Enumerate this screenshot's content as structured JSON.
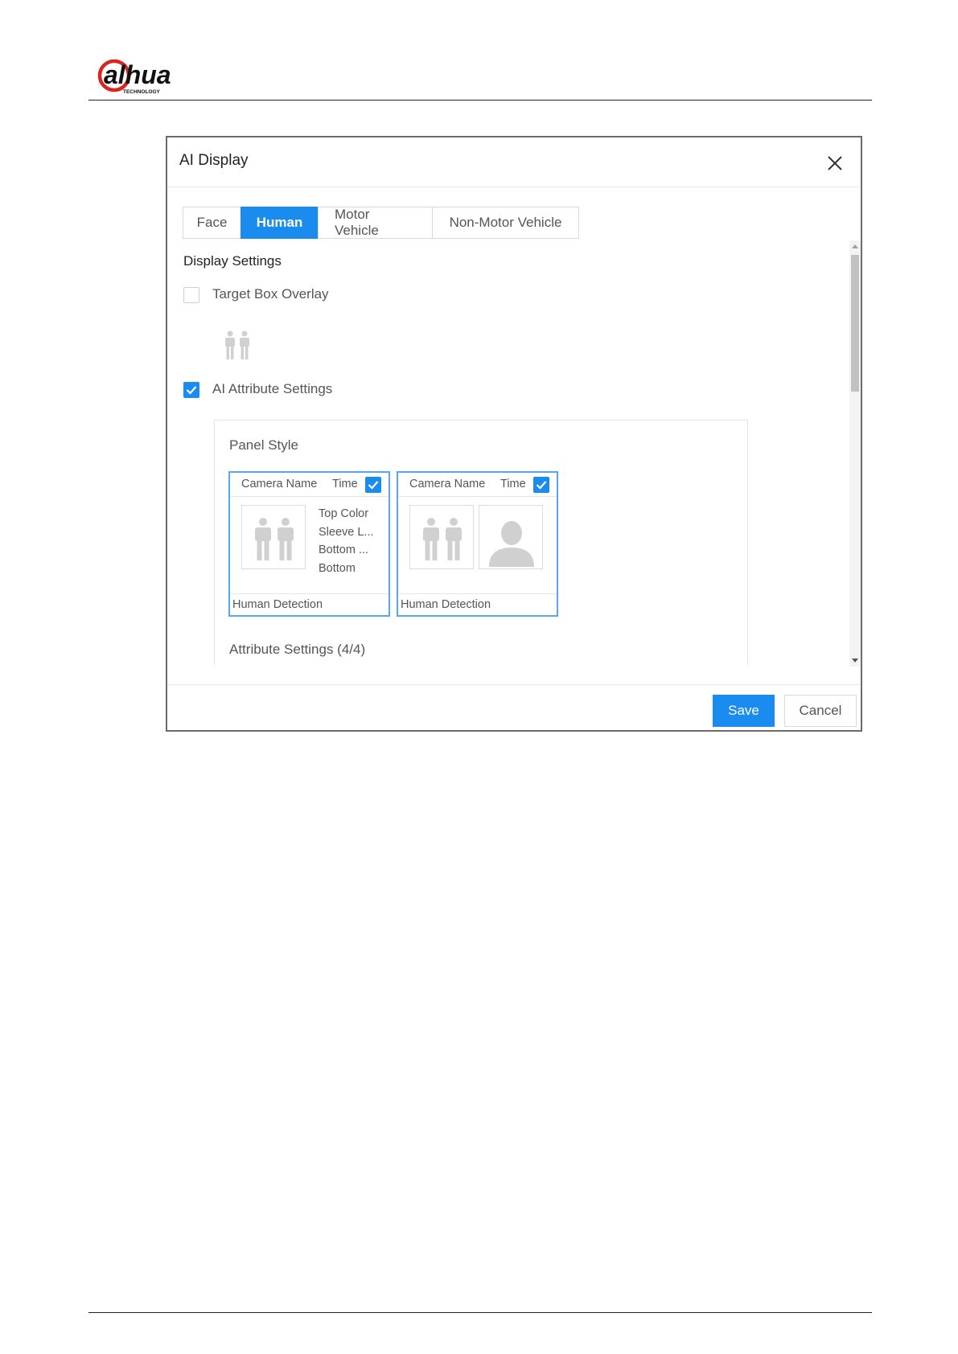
{
  "brand": {
    "logo_name": "alhua",
    "logo_sub": "TECHNOLOGY",
    "colors": {
      "brand_red": "#d9251d",
      "brand_dark": "#111111"
    }
  },
  "dialog": {
    "title": "AI Display",
    "close_icon": "close-icon",
    "tabs": [
      {
        "label": "Face",
        "active": false
      },
      {
        "label": "Human",
        "active": true
      },
      {
        "label": "Motor Vehicle",
        "active": false
      },
      {
        "label": "Non-Motor Vehicle",
        "active": false
      }
    ],
    "display_settings": {
      "title": "Display Settings",
      "target_box_overlay": {
        "label": "Target Box Overlay",
        "checked": false
      },
      "ai_attribute_settings": {
        "label": "AI Attribute Settings",
        "checked": true
      }
    },
    "panel": {
      "panel_style_label": "Panel Style",
      "cards": [
        {
          "camera_name": "Camera Name",
          "time": "Time",
          "checked": true,
          "attributes": [
            "Top Color",
            "Sleeve L...",
            "Bottom ...",
            "Bottom"
          ],
          "footer": "Human Detection"
        },
        {
          "camera_name": "Camera Name",
          "time": "Time",
          "checked": true,
          "footer": "Human Detection"
        }
      ],
      "attribute_settings_label": "Attribute Settings (4/4)"
    },
    "footer": {
      "save_label": "Save",
      "cancel_label": "Cancel"
    },
    "colors": {
      "accent": "#1a8cf0",
      "card_border": "#59a7ef"
    }
  }
}
